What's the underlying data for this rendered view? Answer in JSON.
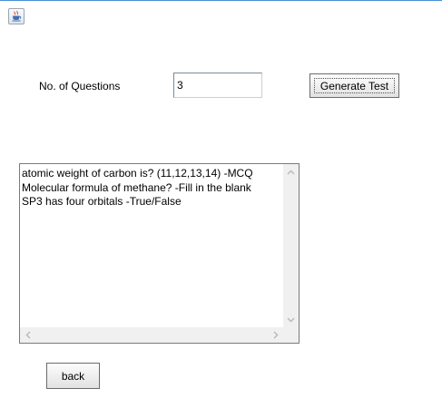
{
  "window": {
    "icon": "java-coffee-cup-icon",
    "accent_color": "#4a90d9"
  },
  "form": {
    "questions_label": "No. of Questions",
    "questions_value": "3",
    "generate_label": "Generate Test"
  },
  "output": {
    "lines": [
      "atomic weight of carbon is? (11,12,13,14) -MCQ",
      "Molecular formula of methane? -Fill in the blank",
      "SP3 has four orbitals -True/False"
    ]
  },
  "footer": {
    "back_label": "back"
  }
}
